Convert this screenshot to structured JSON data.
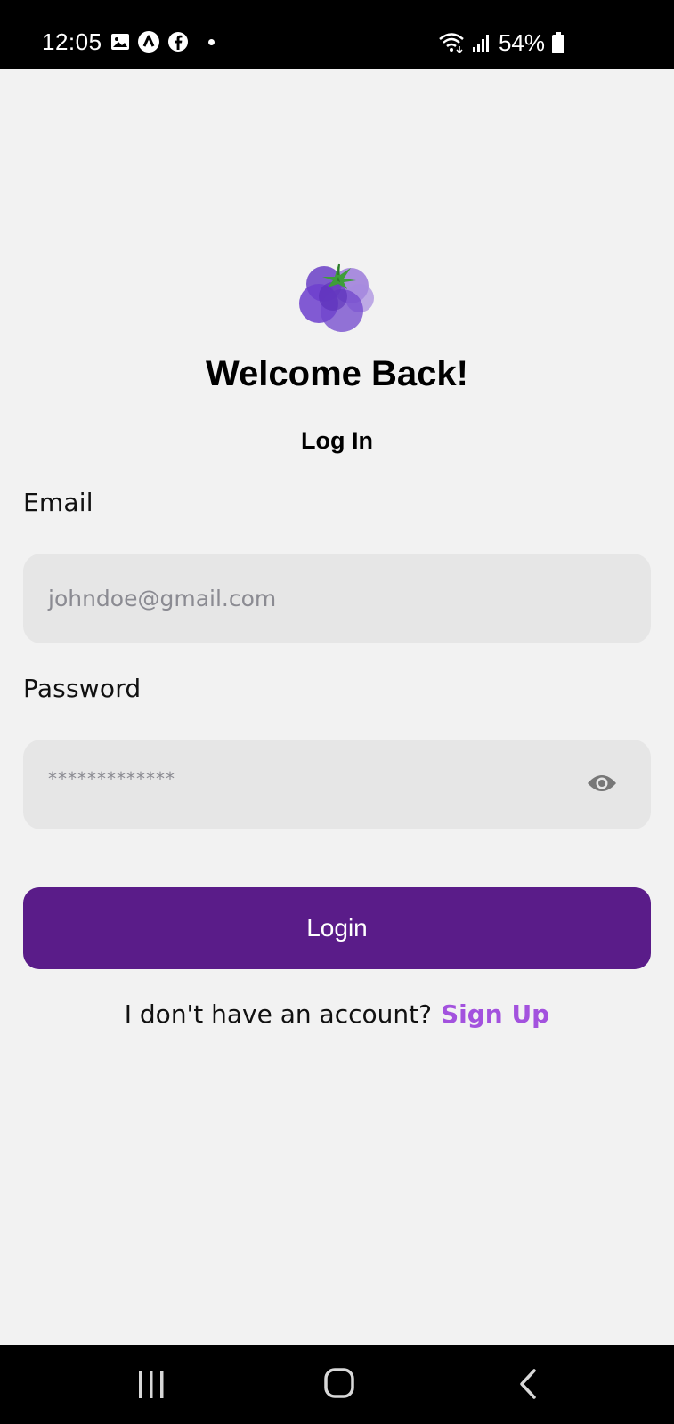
{
  "status_bar": {
    "time": "12:05",
    "battery_percent": "54%"
  },
  "content": {
    "title": "Welcome Back!",
    "subtitle": "Log In",
    "email": {
      "label": "Email",
      "placeholder": "johndoe@gmail.com"
    },
    "password": {
      "label": "Password",
      "placeholder": "*************"
    },
    "login_label": "Login",
    "signup_prompt": "I don't have an account?",
    "signup_link": "Sign Up"
  },
  "colors": {
    "primary": "#5a1c89",
    "link": "#a352de",
    "background": "#f2f2f2",
    "input_bg": "#e6e6e6"
  }
}
